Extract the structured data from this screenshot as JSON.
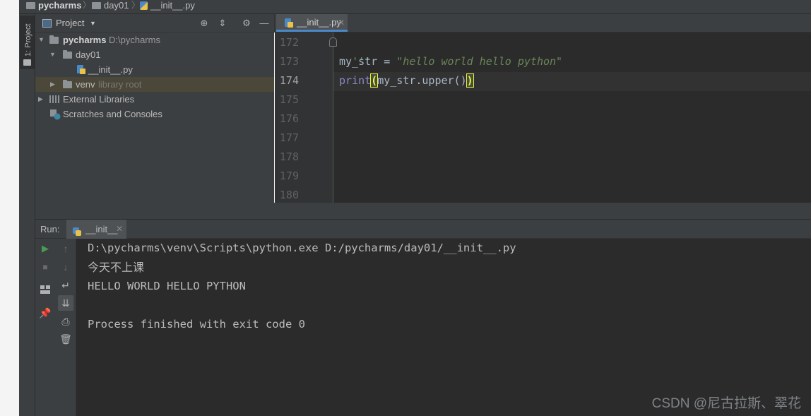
{
  "breadcrumb": {
    "project": "pycharms",
    "folder": "day01",
    "file": "__init__.py"
  },
  "tool_stripe": {
    "project_label": "1: Project"
  },
  "project_panel": {
    "title": "Project",
    "tree": [
      {
        "name": "pycharms",
        "hint": "D:\\pycharms",
        "icon": "folder-icon",
        "expanded": true
      },
      {
        "name": "day01",
        "hint": "",
        "icon": "folder-icon",
        "expanded": true
      },
      {
        "name": "__init__.py",
        "hint": "",
        "icon": "python-file-icon"
      },
      {
        "name": "venv",
        "hint": "library root",
        "icon": "folder-icon",
        "expanded": false
      },
      {
        "name": "External Libraries",
        "hint": "",
        "icon": "libraries-icon",
        "expanded": false
      },
      {
        "name": "Scratches and Consoles",
        "hint": "",
        "icon": "scratches-icon"
      }
    ]
  },
  "editor": {
    "tab_label": "__init__.py",
    "line_numbers": [
      "172",
      "173",
      "174",
      "175",
      "176",
      "177",
      "178",
      "179",
      "180"
    ],
    "current_line": "174",
    "code": {
      "line172": "'''",
      "line173_var": "my_str = ",
      "line173_str": "\"hello world hello python\"",
      "line174_kw": "print",
      "line174_open": "(",
      "line174_arg": "my_str.upper()",
      "line174_close": ")"
    }
  },
  "run_panel": {
    "label": "Run:",
    "tab_label": "__init__",
    "output": [
      "D:\\pycharms\\venv\\Scripts\\python.exe D:/pycharms/day01/__init__.py",
      "今天不上课",
      "HELLO WORLD HELLO PYTHON",
      "",
      "Process finished with exit code 0"
    ]
  },
  "watermark": "CSDN @尼古拉斯、翠花",
  "colors": {
    "background": "#2b2b2b",
    "panel": "#3c3f41",
    "keyword": "#8888c6",
    "string": "#6a8759",
    "brace_highlight": "#ffef28",
    "run_green": "#499c54",
    "selection": "#4b4839"
  }
}
